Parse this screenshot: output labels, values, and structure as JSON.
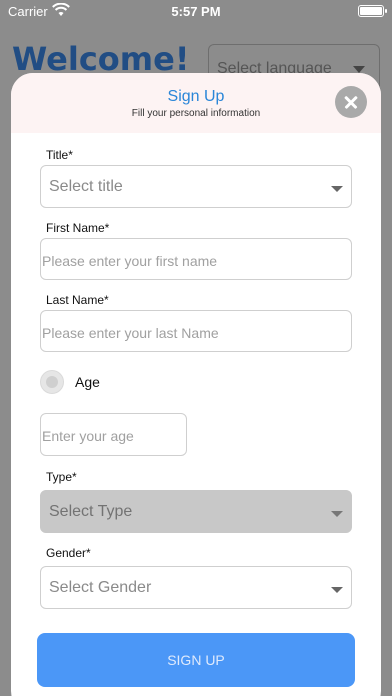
{
  "status_bar": {
    "carrier": "Carrier",
    "time": "5:57 PM",
    "battery_level": 1.0
  },
  "background": {
    "welcome_title": "Welcome!",
    "language_placeholder": "Select language"
  },
  "modal": {
    "title": "Sign Up",
    "subtitle": "Fill your personal information",
    "fields": {
      "title": {
        "label": "Title*",
        "placeholder": "Select title"
      },
      "first_name": {
        "label": "First Name*",
        "placeholder": "Please enter your first name"
      },
      "last_name": {
        "label": "Last Name*",
        "placeholder": "Please enter your last Name"
      },
      "age_option": {
        "label": "Age",
        "selected": false
      },
      "age": {
        "placeholder": "Enter your age"
      },
      "type": {
        "label": "Type*",
        "placeholder": "Select Type",
        "disabled": true
      },
      "gender": {
        "label": "Gender*",
        "placeholder": "Select Gender"
      }
    },
    "submit_label": "SIGN UP"
  },
  "colors": {
    "accent": "#4b97f7",
    "title_blue": "#2a86d8",
    "welcome_blue": "#214d84",
    "overlay": "#8c8c8c",
    "header_tint": "#fdf3f3"
  }
}
